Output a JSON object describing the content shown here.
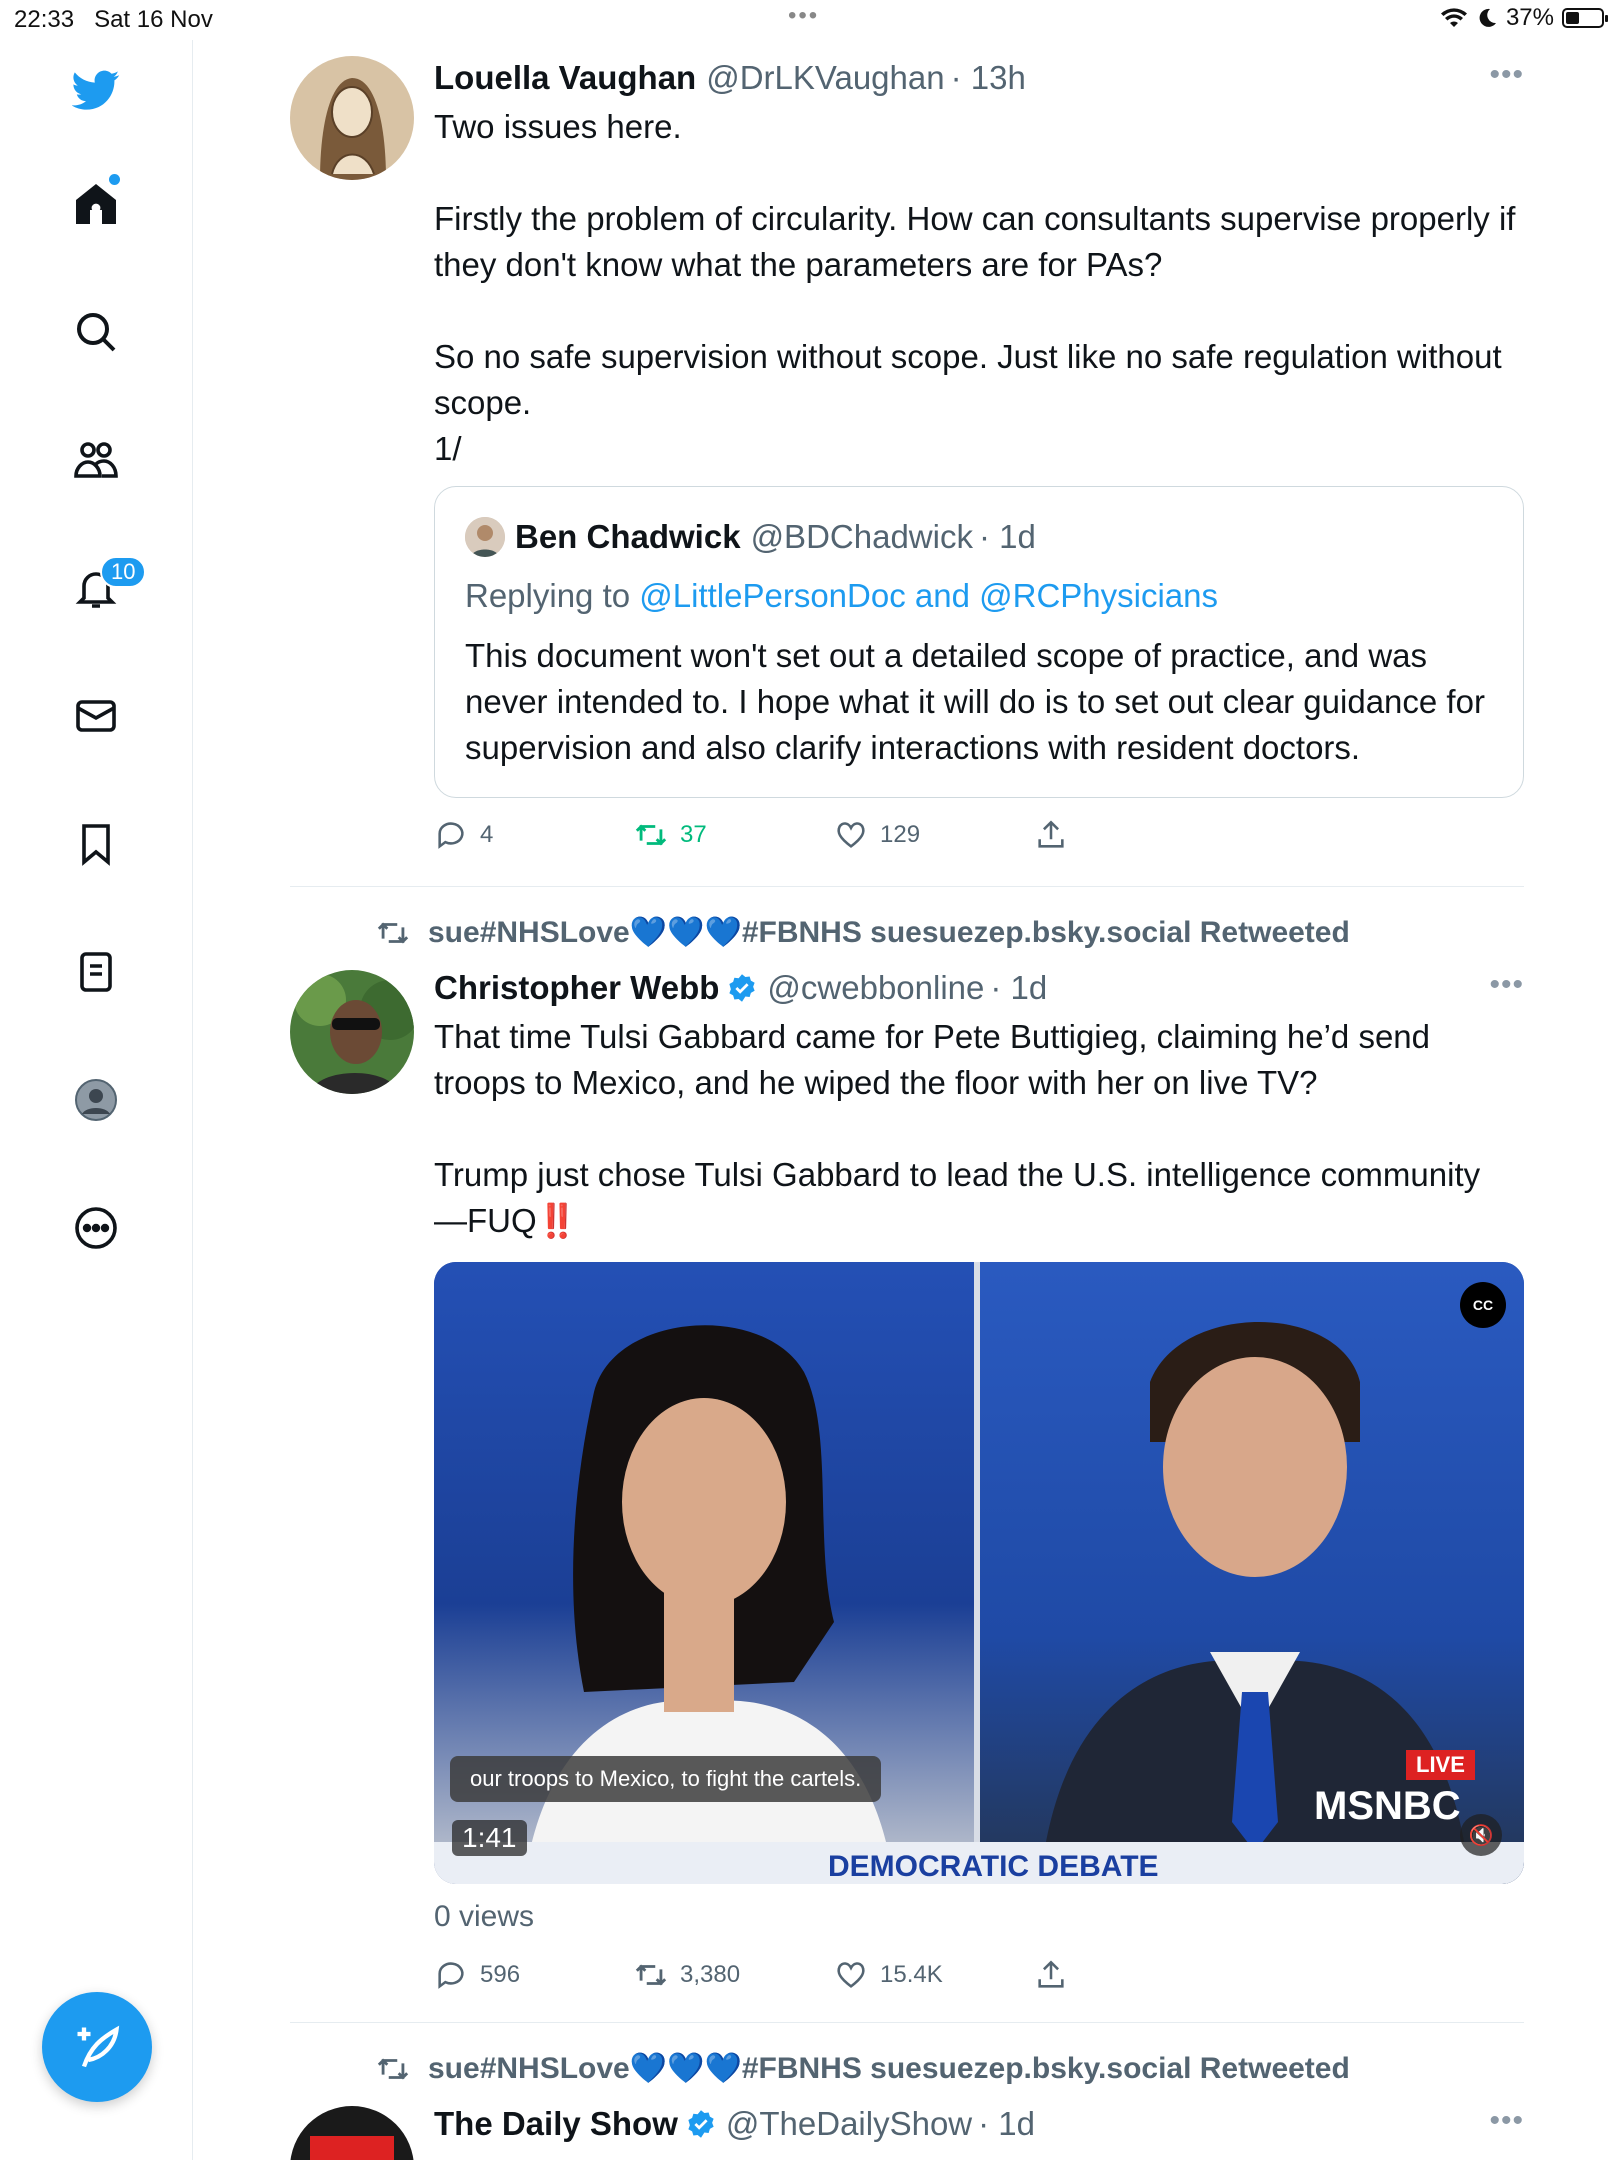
{
  "status": {
    "time": "22:33",
    "date": "Sat 16 Nov",
    "battery": "37%",
    "battery_level": 0.37,
    "dots": "•••"
  },
  "sidebar": {
    "notification_count": "10"
  },
  "colors": {
    "accent": "#1d9bf0",
    "retweet": "#00ba7c",
    "text": "#0f1419",
    "muted": "#536471"
  },
  "tweet1": {
    "name": "Louella Vaughan",
    "handle": "@DrLKVaughan",
    "time": "· 13h",
    "more": "•••",
    "text": "Two issues here.\n\nFirstly the problem of circularity. How can consultants supervise properly if they don't know what the parameters are for PAs?\n\nSo no safe supervision without scope. Just like no safe regulation without scope.\n1/",
    "quote": {
      "name": "Ben Chadwick",
      "handle": "@BDChadwick",
      "time": "· 1d",
      "replying_prefix": "Replying to ",
      "replying_to": "@LittlePersonDoc and @RCPhysicians",
      "text": "This document won't set out a detailed scope of practice, and was never intended to. I hope what it will do is to set out clear guidance for supervision and also clarify interactions with resident doctors."
    },
    "replies": "4",
    "retweets": "37",
    "likes": "129"
  },
  "tweet2": {
    "retweeted_by": "sue#NHSLove",
    "retweeted_by_hearts": "💙💙💙",
    "retweeted_by_suffix": "#FBNHS suesuezep.bsky.social Retweeted",
    "name": "Christopher Webb",
    "handle": "@cwebbonline",
    "time": "· 1d",
    "more": "•••",
    "text": "That time Tulsi Gabbard came for Pete Buttigieg, claiming he’d send troops to Mexico, and he wiped the floor with her on live TV?\n\nTrump just chose Tulsi Gabbard to lead the U.S. intelligence community\n—FUQ",
    "emphasis": "‼️",
    "video": {
      "caption": "our troops to Mexico, to fight the cartels.",
      "duration": "1:41",
      "cc": "CC",
      "live": "LIVE",
      "network": "MSNBC",
      "banner": "DEMOCRATIC DEBATE",
      "mute": "🔇"
    },
    "views": "0 views",
    "replies": "596",
    "retweets": "3,380",
    "likes": "15.4K"
  },
  "tweet3": {
    "retweeted_by": "sue#NHSLove",
    "retweeted_by_hearts": "💙💙💙",
    "retweeted_by_suffix": "#FBNHS suesuezep.bsky.social Retweeted",
    "name": "The Daily Show",
    "handle": "@TheDailyShow",
    "time": "· 1d",
    "more": "•••"
  }
}
